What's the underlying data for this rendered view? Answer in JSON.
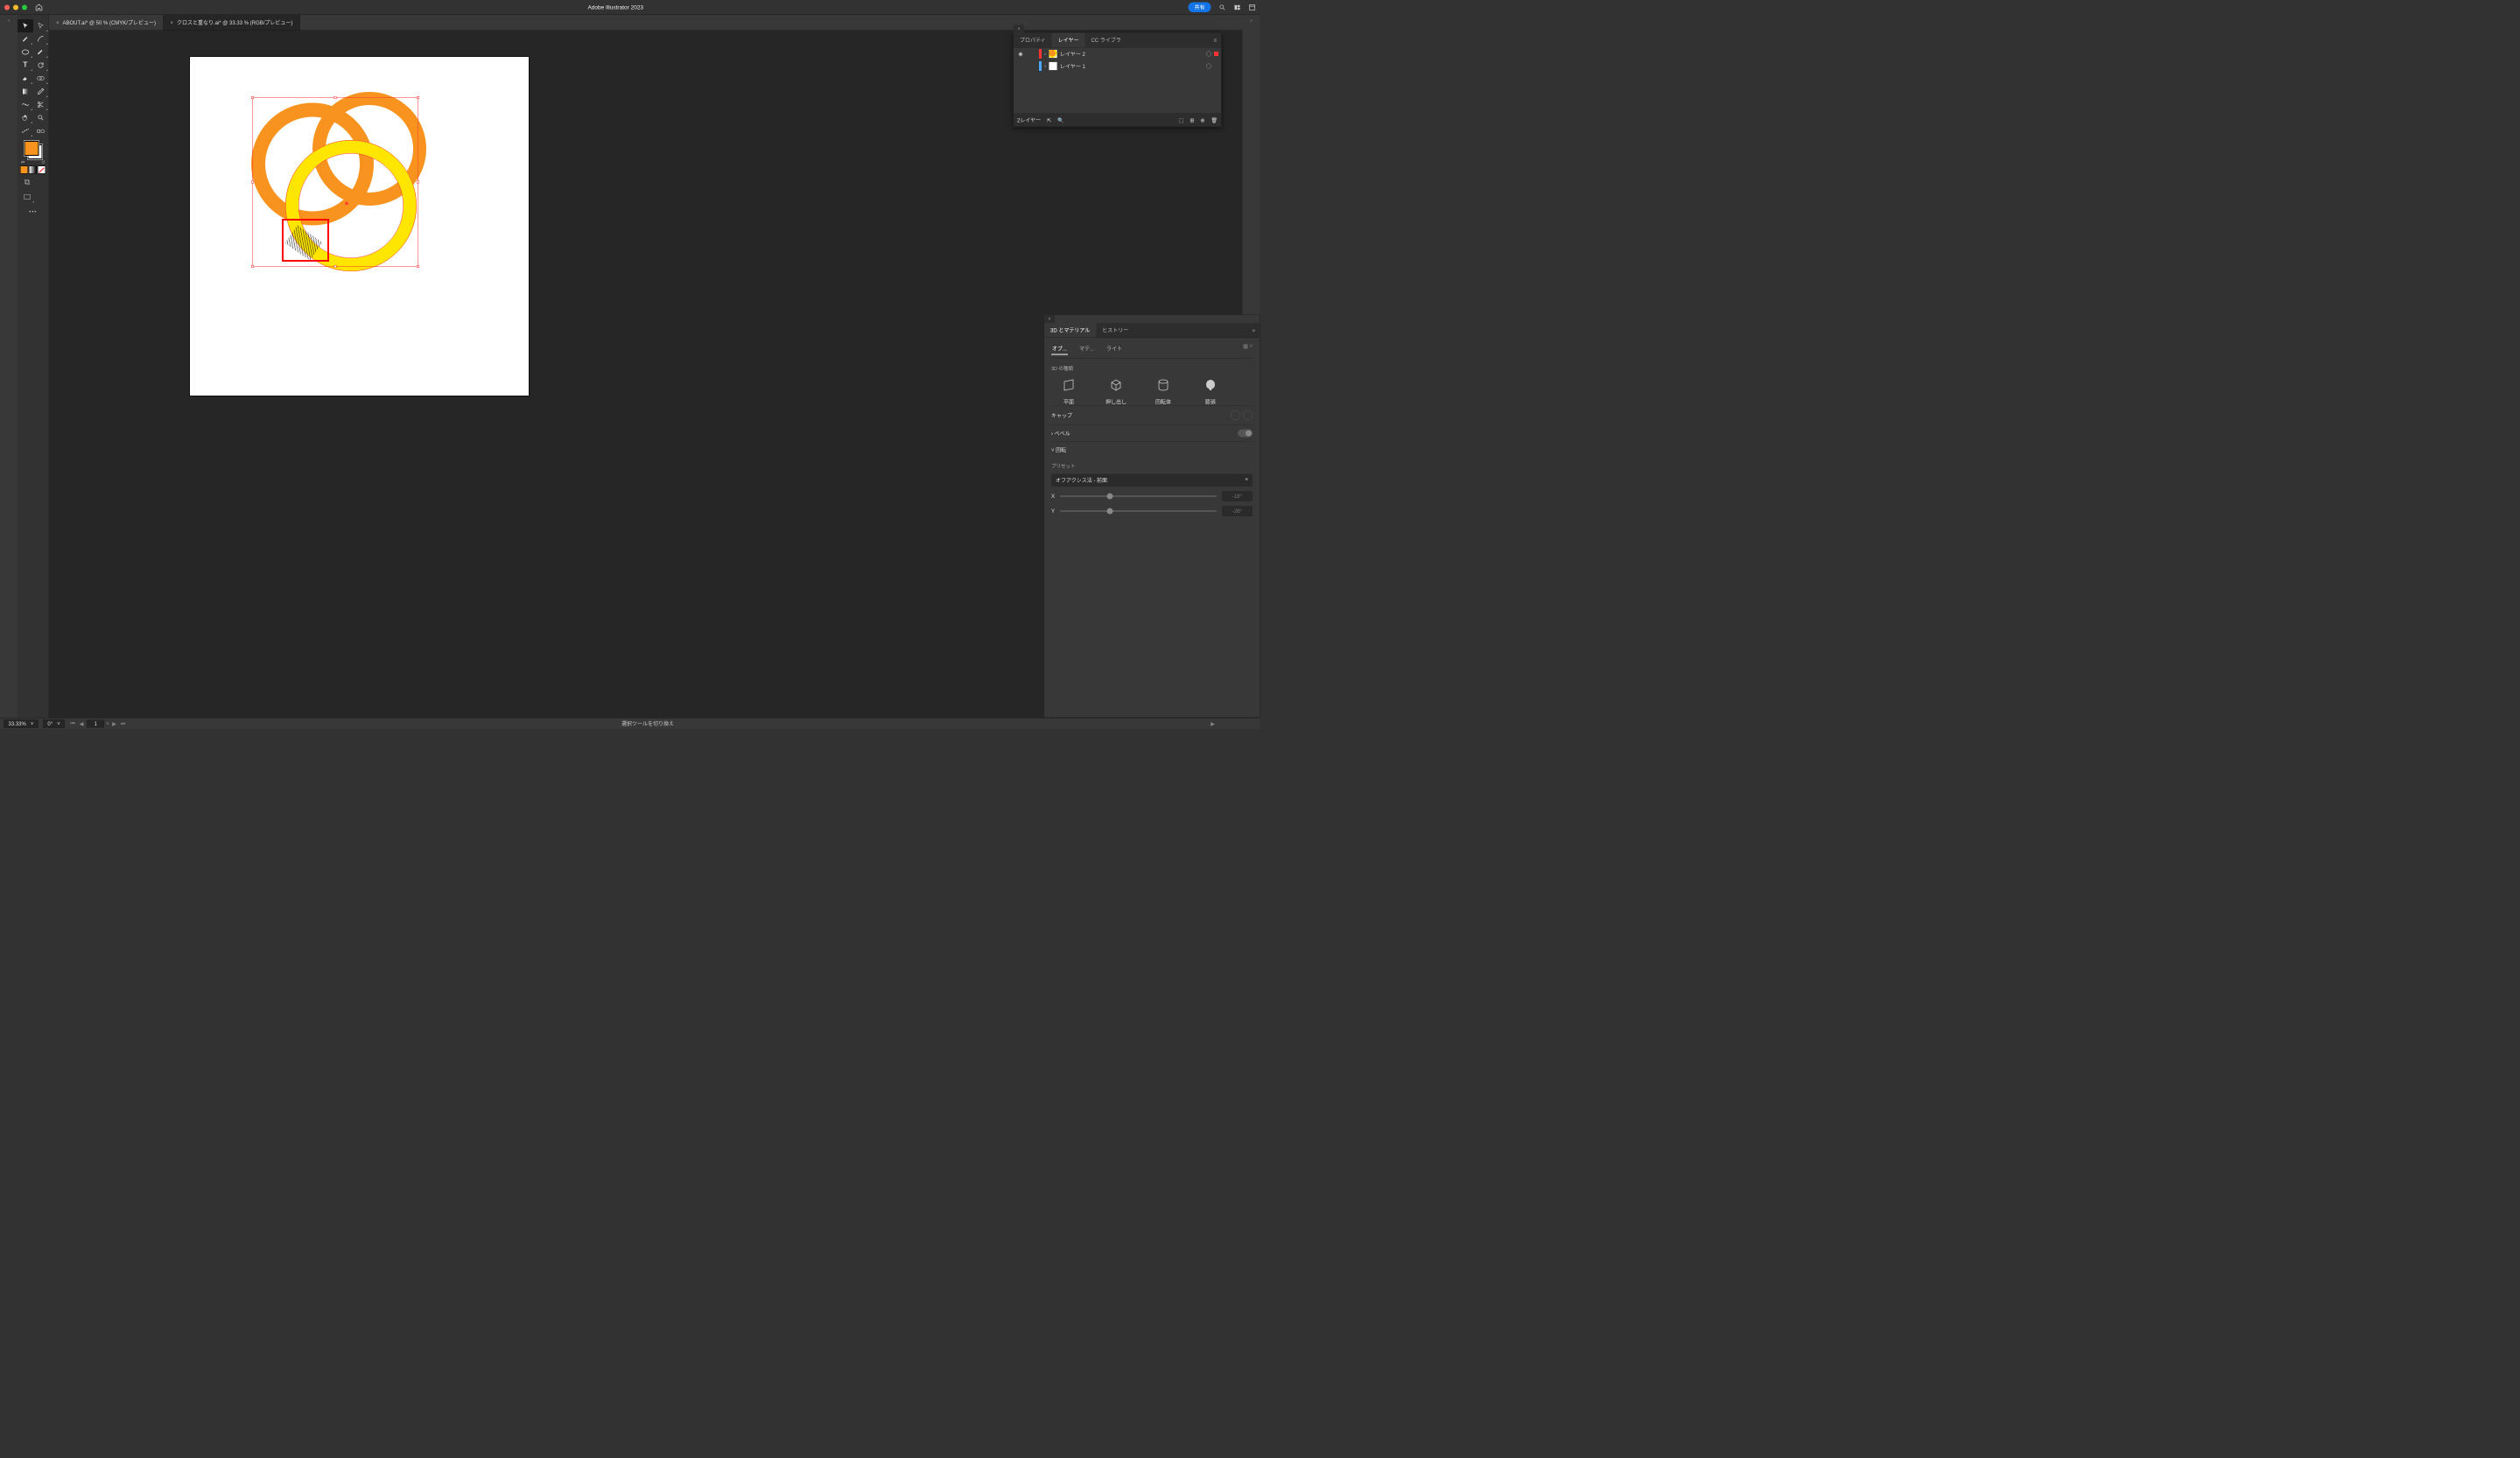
{
  "titlebar": {
    "app_title": "Adobe Illustrator 2023",
    "share": "共有"
  },
  "tabs": [
    {
      "label": "ABOUT.ai* @ 50 % (CMYK/プレビュー)"
    },
    {
      "label": "クロスと重なり.ai* @ 33.33 % (RGB/プレビュー)"
    }
  ],
  "layers_panel": {
    "tabs": [
      "プロパティ",
      "レイヤー",
      "CC ライブラ"
    ],
    "rows": [
      {
        "name": "レイヤー 2",
        "color": "#ff0000",
        "thumb": "#f7931e",
        "visible": true,
        "selected": true
      },
      {
        "name": "レイヤー 1",
        "color": "#4aa8ff",
        "thumb": "#ffffff",
        "visible": false,
        "selected": false
      }
    ],
    "footer": "2レイヤー"
  },
  "material_panel": {
    "tabs": [
      "3D とマテリアル",
      "ヒストリー"
    ],
    "subtabs": [
      "オブ...",
      "マテ...",
      "ライト"
    ],
    "section_type": "3D の種類",
    "types": [
      "平面",
      "押し出し",
      "回転体",
      "膨張"
    ],
    "cap": "キャップ",
    "bevel": "ベベル",
    "rotation": "回転",
    "preset_label": "プリセット",
    "preset_value": "オフアクシス法 - 前面",
    "axes": [
      {
        "k": "X",
        "v": "-18°"
      },
      {
        "k": "Y",
        "v": "-26°"
      }
    ]
  },
  "statusbar": {
    "zoom": "33.33%",
    "rotate": "0°",
    "artboard": "1",
    "hint": "選択ツールを切り換え"
  },
  "colors": {
    "ring_orange": "#f7931e",
    "ring_yellow": "#ffe600",
    "sel": "#ff3333",
    "red": "#ff0000"
  }
}
